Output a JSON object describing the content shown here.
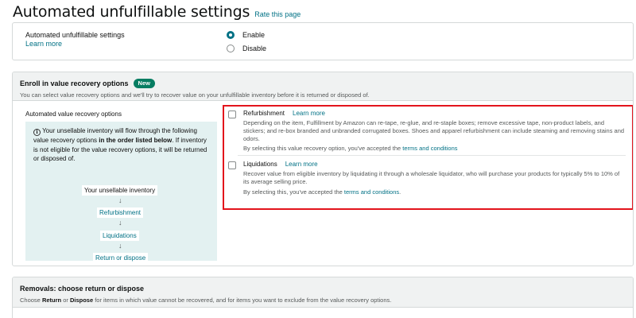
{
  "header": {
    "title": "Automated unfulfillable settings",
    "rate_link": "Rate this page"
  },
  "automated_settings": {
    "label": "Automated unfulfillable settings",
    "learn_more": "Learn more",
    "options": [
      {
        "label": "Enable",
        "checked": true
      },
      {
        "label": "Disable",
        "checked": false
      }
    ]
  },
  "value_recovery": {
    "title": "Enroll in value recovery options",
    "badge": "New",
    "description": "You can select value recovery options and we'll try to recover value on your unfulfillable inventory before it is returned or disposed of.",
    "left_label": "Automated value recovery options",
    "info": {
      "icon": "info-icon",
      "text_before": "Your unsellable inventory will flow through the following value recovery options ",
      "text_bold": "in the order listed below",
      "text_after": ". If inventory is not eligible for the value recovery options, it will be returned or disposed of."
    },
    "flow": [
      {
        "label": "Your unsellable inventory"
      },
      {
        "label": "Refurbishment"
      },
      {
        "label": "Liquidations"
      },
      {
        "label": "Return or dispose"
      }
    ],
    "arrow": "↓",
    "options": [
      {
        "title": "Refurbishment",
        "learn_more": "Learn more",
        "checked": false,
        "description": "Depending on the item, Fulfillment by Amazon can re-tape, re-glue, and re-staple boxes; remove excessive tape, non-product labels, and stickers; and re-box branded and unbranded corrugated boxes. Shoes and apparel refurbishment can include steaming and removing stains and odors.",
        "accept_prefix": "By selecting this value recovery option, you've accepted the ",
        "accept_link": "terms and conditions",
        "accept_suffix": ""
      },
      {
        "title": "Liquidations",
        "learn_more": "Learn more",
        "checked": false,
        "description": "Recover value from eligible inventory by liquidating it through a wholesale liquidator, who will purchase your products for typically 5% to 10% of its average selling price.",
        "accept_prefix": "By selecting this, you've accepted the ",
        "accept_link": "terms and conditions",
        "accept_suffix": "."
      }
    ]
  },
  "removals": {
    "title": "Removals: choose return or dispose",
    "desc_1": "Choose ",
    "desc_bold_1": "Return",
    "desc_2": " or ",
    "desc_bold_2": "Dispose",
    "desc_3": " for items in which value cannot be recovered, and for items you want to exclude from the value recovery options."
  },
  "colors": {
    "link": "#007185",
    "accent": "#007185",
    "badge": "#067d62",
    "highlight": "#e3141c"
  }
}
